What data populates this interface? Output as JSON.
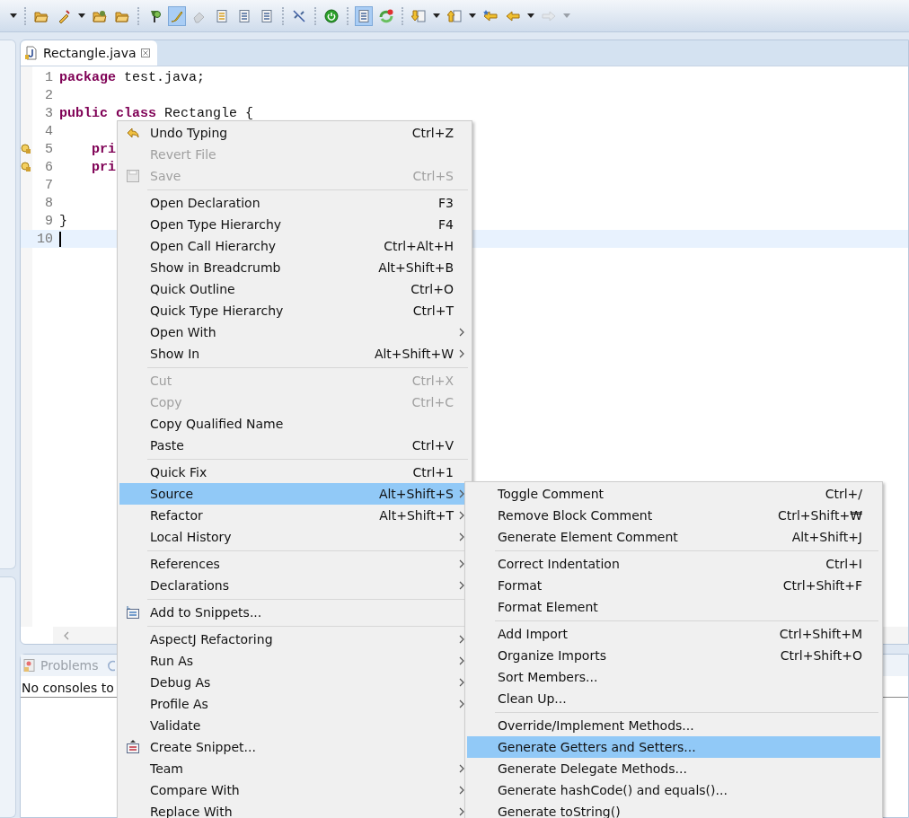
{
  "toolbar": {
    "items": [
      {
        "kind": "caret",
        "disabled": false
      },
      {
        "kind": "separator"
      },
      {
        "kind": "button",
        "pressed": false,
        "disabled": false
      },
      {
        "kind": "button",
        "pressed": false,
        "disabled": false
      },
      {
        "kind": "caret",
        "disabled": false
      },
      {
        "kind": "button",
        "pressed": false,
        "disabled": false
      },
      {
        "kind": "button",
        "pressed": false,
        "disabled": false
      },
      {
        "kind": "separator"
      },
      {
        "kind": "button",
        "pressed": false,
        "disabled": false
      },
      {
        "kind": "button",
        "pressed": true,
        "disabled": false
      },
      {
        "kind": "button",
        "pressed": false,
        "disabled": true
      },
      {
        "kind": "button",
        "pressed": false,
        "disabled": false
      },
      {
        "kind": "button",
        "pressed": false,
        "disabled": false
      },
      {
        "kind": "button",
        "pressed": false,
        "disabled": false
      },
      {
        "kind": "separator"
      },
      {
        "kind": "button",
        "pressed": false,
        "disabled": false
      },
      {
        "kind": "separator"
      },
      {
        "kind": "button",
        "pressed": false,
        "disabled": false
      },
      {
        "kind": "separator"
      },
      {
        "kind": "button",
        "pressed": true,
        "disabled": false
      },
      {
        "kind": "button",
        "pressed": false,
        "disabled": false
      },
      {
        "kind": "separator"
      },
      {
        "kind": "button",
        "pressed": false,
        "disabled": false
      },
      {
        "kind": "caret",
        "disabled": false
      },
      {
        "kind": "button",
        "pressed": false,
        "disabled": false
      },
      {
        "kind": "caret",
        "disabled": false
      },
      {
        "kind": "button",
        "pressed": false,
        "disabled": false
      },
      {
        "kind": "button",
        "pressed": false,
        "disabled": false
      },
      {
        "kind": "caret",
        "disabled": false
      },
      {
        "kind": "button",
        "pressed": false,
        "disabled": true
      },
      {
        "kind": "caret",
        "disabled": true
      }
    ]
  },
  "editor": {
    "tab": {
      "title": "Rectangle.java",
      "selected": true
    },
    "lines": [
      {
        "number": "1",
        "marker": false,
        "current": false,
        "tokens": [
          {
            "kind": "keyword",
            "text": "package"
          },
          {
            "kind": "plain",
            "text": " test.java;"
          }
        ]
      },
      {
        "number": "2",
        "marker": false,
        "current": false
      },
      {
        "number": "3",
        "marker": false,
        "current": false,
        "tokens": [
          {
            "kind": "keyword",
            "text": "public class"
          },
          {
            "kind": "plain",
            "text": " Rectangle {"
          }
        ]
      },
      {
        "number": "4",
        "marker": false,
        "current": false
      },
      {
        "number": "5",
        "marker": true,
        "current": false,
        "tokens": [
          {
            "kind": "keyword",
            "text": "    pri"
          }
        ]
      },
      {
        "number": "6",
        "marker": true,
        "current": false,
        "tokens": [
          {
            "kind": "keyword",
            "text": "    pri"
          }
        ]
      },
      {
        "number": "7",
        "marker": false,
        "current": false
      },
      {
        "number": "8",
        "marker": false,
        "current": false
      },
      {
        "number": "9",
        "marker": false,
        "current": false,
        "tokens": [
          {
            "kind": "plain",
            "text": "}"
          }
        ]
      },
      {
        "number": "10",
        "marker": false,
        "current": true
      }
    ]
  },
  "problems": {
    "tab": {
      "title": "Problems",
      "selected": false
    },
    "message": "No consoles to"
  },
  "context_menu": {
    "groups": [
      [
        {
          "label": "Undo Typing",
          "shortcut": "Ctrl+Z",
          "disabled": false,
          "submenu": false,
          "selected": false
        },
        {
          "label": "Revert File",
          "disabled": true,
          "submenu": false,
          "selected": false
        },
        {
          "label": "Save",
          "shortcut": "Ctrl+S",
          "disabled": true,
          "submenu": false,
          "selected": false
        }
      ],
      [
        {
          "label": "Open Declaration",
          "shortcut": "F3",
          "disabled": false,
          "submenu": false,
          "selected": false
        },
        {
          "label": "Open Type Hierarchy",
          "shortcut": "F4",
          "disabled": false,
          "submenu": false,
          "selected": false
        },
        {
          "label": "Open Call Hierarchy",
          "shortcut": "Ctrl+Alt+H",
          "disabled": false,
          "submenu": false,
          "selected": false
        },
        {
          "label": "Show in Breadcrumb",
          "shortcut": "Alt+Shift+B",
          "disabled": false,
          "submenu": false,
          "selected": false
        },
        {
          "label": "Quick Outline",
          "shortcut": "Ctrl+O",
          "disabled": false,
          "submenu": false,
          "selected": false
        },
        {
          "label": "Quick Type Hierarchy",
          "shortcut": "Ctrl+T",
          "disabled": false,
          "submenu": false,
          "selected": false
        },
        {
          "label": "Open With",
          "disabled": false,
          "submenu": true,
          "selected": false
        },
        {
          "label": "Show In",
          "shortcut": "Alt+Shift+W",
          "disabled": false,
          "submenu": true,
          "selected": false
        }
      ],
      [
        {
          "label": "Cut",
          "shortcut": "Ctrl+X",
          "disabled": true,
          "submenu": false,
          "selected": false
        },
        {
          "label": "Copy",
          "shortcut": "Ctrl+C",
          "disabled": true,
          "submenu": false,
          "selected": false
        },
        {
          "label": "Copy Qualified Name",
          "disabled": false,
          "submenu": false,
          "selected": false
        },
        {
          "label": "Paste",
          "shortcut": "Ctrl+V",
          "disabled": false,
          "submenu": false,
          "selected": false
        }
      ],
      [
        {
          "label": "Quick Fix",
          "shortcut": "Ctrl+1",
          "disabled": false,
          "submenu": false,
          "selected": false
        },
        {
          "label": "Source",
          "shortcut": "Alt+Shift+S",
          "disabled": false,
          "submenu": true,
          "selected": true
        },
        {
          "label": "Refactor",
          "shortcut": "Alt+Shift+T",
          "disabled": false,
          "submenu": true,
          "selected": false
        },
        {
          "label": "Local History",
          "disabled": false,
          "submenu": true,
          "selected": false
        }
      ],
      [
        {
          "label": "References",
          "disabled": false,
          "submenu": true,
          "selected": false
        },
        {
          "label": "Declarations",
          "disabled": false,
          "submenu": true,
          "selected": false
        }
      ],
      [
        {
          "label": "Add to Snippets...",
          "disabled": false,
          "submenu": false,
          "selected": false
        }
      ],
      [
        {
          "label": "AspectJ Refactoring",
          "disabled": false,
          "submenu": true,
          "selected": false
        },
        {
          "label": "Run As",
          "disabled": false,
          "submenu": true,
          "selected": false
        },
        {
          "label": "Debug As",
          "disabled": false,
          "submenu": true,
          "selected": false
        },
        {
          "label": "Profile As",
          "disabled": false,
          "submenu": true,
          "selected": false
        },
        {
          "label": "Validate",
          "disabled": false,
          "submenu": false,
          "selected": false
        },
        {
          "label": "Create Snippet...",
          "disabled": false,
          "submenu": false,
          "selected": false
        },
        {
          "label": "Team",
          "disabled": false,
          "submenu": true,
          "selected": false
        },
        {
          "label": "Compare With",
          "disabled": false,
          "submenu": true,
          "selected": false
        },
        {
          "label": "Replace With",
          "disabled": false,
          "submenu": true,
          "selected": false
        }
      ]
    ]
  },
  "source_submenu": {
    "groups": [
      [
        {
          "label": "Toggle Comment",
          "shortcut": "Ctrl+/",
          "disabled": false,
          "submenu": false,
          "selected": false
        },
        {
          "label": "Remove Block Comment",
          "shortcut": "Ctrl+Shift+₩",
          "disabled": false,
          "submenu": false,
          "selected": false
        },
        {
          "label": "Generate Element Comment",
          "shortcut": "Alt+Shift+J",
          "disabled": false,
          "submenu": false,
          "selected": false
        }
      ],
      [
        {
          "label": "Correct Indentation",
          "shortcut": "Ctrl+I",
          "disabled": false,
          "submenu": false,
          "selected": false
        },
        {
          "label": "Format",
          "shortcut": "Ctrl+Shift+F",
          "disabled": false,
          "submenu": false,
          "selected": false
        },
        {
          "label": "Format Element",
          "disabled": false,
          "submenu": false,
          "selected": false
        }
      ],
      [
        {
          "label": "Add Import",
          "shortcut": "Ctrl+Shift+M",
          "disabled": false,
          "submenu": false,
          "selected": false
        },
        {
          "label": "Organize Imports",
          "shortcut": "Ctrl+Shift+O",
          "disabled": false,
          "submenu": false,
          "selected": false
        },
        {
          "label": "Sort Members...",
          "disabled": false,
          "submenu": false,
          "selected": false
        },
        {
          "label": "Clean Up...",
          "disabled": false,
          "submenu": false,
          "selected": false
        }
      ],
      [
        {
          "label": "Override/Implement Methods...",
          "disabled": false,
          "submenu": false,
          "selected": false
        },
        {
          "label": "Generate Getters and Setters...",
          "disabled": false,
          "submenu": false,
          "selected": true
        },
        {
          "label": "Generate Delegate Methods...",
          "disabled": false,
          "submenu": false,
          "selected": false
        },
        {
          "label": "Generate hashCode() and equals()...",
          "disabled": false,
          "submenu": false,
          "selected": false
        },
        {
          "label": "Generate toString()",
          "disabled": false,
          "submenu": false,
          "selected": false
        }
      ]
    ]
  }
}
